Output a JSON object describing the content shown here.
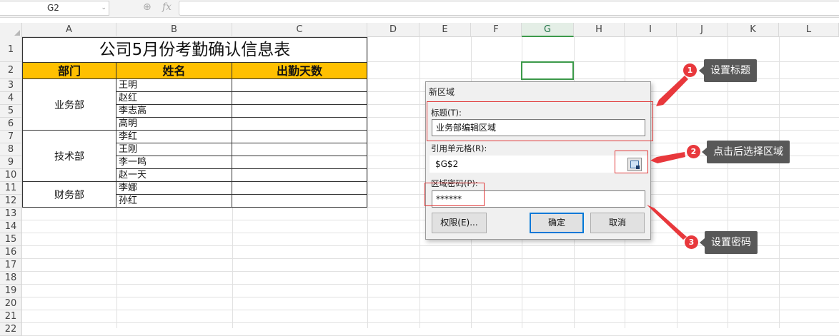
{
  "formula_bar": {
    "name_box": "G2",
    "fx_label": "fx",
    "formula_value": ""
  },
  "columns": [
    "A",
    "B",
    "C",
    "D",
    "E",
    "F",
    "G",
    "H",
    "I",
    "J",
    "K",
    "L"
  ],
  "selected_column": "G",
  "rows": [
    "1",
    "2",
    "3",
    "4",
    "5",
    "6",
    "7",
    "8",
    "9",
    "10",
    "11",
    "12",
    "13",
    "14",
    "15",
    "16",
    "17",
    "18",
    "19",
    "20",
    "21",
    "22"
  ],
  "table": {
    "title": "公司5月份考勤确认信息表",
    "headers": [
      "部门",
      "姓名",
      "出勤天数"
    ],
    "departments": [
      {
        "name": "业务部",
        "staff": [
          "王明",
          "赵红",
          "李志高",
          "高明"
        ]
      },
      {
        "name": "技术部",
        "staff": [
          "李红",
          "王刚",
          "李一鸣",
          "赵一天"
        ]
      },
      {
        "name": "财务部",
        "staff": [
          "李娜",
          "孙红"
        ]
      }
    ]
  },
  "dialog": {
    "title": "新区域",
    "title_label": "标题(T):",
    "title_value": "业务部编辑区域",
    "ref_label": "引用单元格(R):",
    "ref_value": "$G$2",
    "password_label": "区域密码(P):",
    "password_value": "******",
    "permissions_button": "权限(E)...",
    "ok_button": "确定",
    "cancel_button": "取消"
  },
  "annotations": [
    {
      "number": "1",
      "text": "设置标题"
    },
    {
      "number": "2",
      "text": "点击后选择区域"
    },
    {
      "number": "3",
      "text": "设置密码"
    }
  ],
  "colors": {
    "header_fill": "#ffc000",
    "annotation_red": "#e8383c",
    "callout_bg": "#585858",
    "selection_green": "#3c9a4a"
  }
}
